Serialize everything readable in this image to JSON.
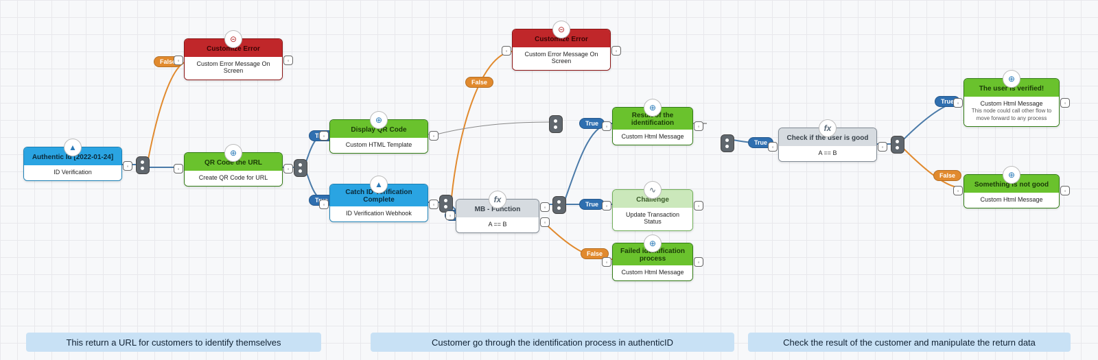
{
  "labels": {
    "true": "True",
    "false": "False"
  },
  "nodes": {
    "authentic": {
      "title": "Authentic Id [2022-01-24]",
      "subtitle": "ID Verification",
      "icon": "shield-icon"
    },
    "customizeError1": {
      "title": "Customize Error",
      "subtitle": "Custom Error Message On Screen",
      "icon": "alert-icon"
    },
    "qrCodeUrl": {
      "title": "QR Code the URL",
      "subtitle": "Create QR Code for URL",
      "icon": "globe-icon"
    },
    "displayQr": {
      "title": "Display QR Code",
      "subtitle": "Custom HTML Template",
      "icon": "globe-icon"
    },
    "catchId": {
      "title": "Catch ID Verification Complete",
      "subtitle": "ID Verification Webhook",
      "icon": "shield-icon"
    },
    "mbFunction": {
      "title": "MB - Function",
      "subtitle": "A == B",
      "icon": "fx-icon"
    },
    "customizeError2": {
      "title": "Customize Error",
      "subtitle": "Custom Error Message On Screen",
      "icon": "alert-icon"
    },
    "resultIdent": {
      "title": "Result of the identification",
      "subtitle": "Custom Html Message",
      "icon": "globe-icon"
    },
    "challenge": {
      "title": "Challenge",
      "subtitle": "Update Transaction Status",
      "icon": "pulse-icon"
    },
    "failedIdent": {
      "title": "Failed identification process",
      "subtitle": "Custom Html Message",
      "icon": "globe-icon"
    },
    "checkUser": {
      "title": "Check if the user is good",
      "subtitle": "A == B",
      "icon": "fx-icon"
    },
    "userVerified": {
      "title": "The user is verified!",
      "subtitle": "Custom Html Message",
      "extra": "This node could call other flow to move forward to any process",
      "icon": "globe-icon"
    },
    "notGood": {
      "title": "Something is not good",
      "subtitle": "Custom Html Message",
      "icon": "globe-icon"
    }
  },
  "legend": {
    "left": "This return a URL for customers to identify themselves",
    "mid": "Customer go through the identification process in authenticID",
    "right": "Check the result of the customer and manipulate the return data"
  }
}
